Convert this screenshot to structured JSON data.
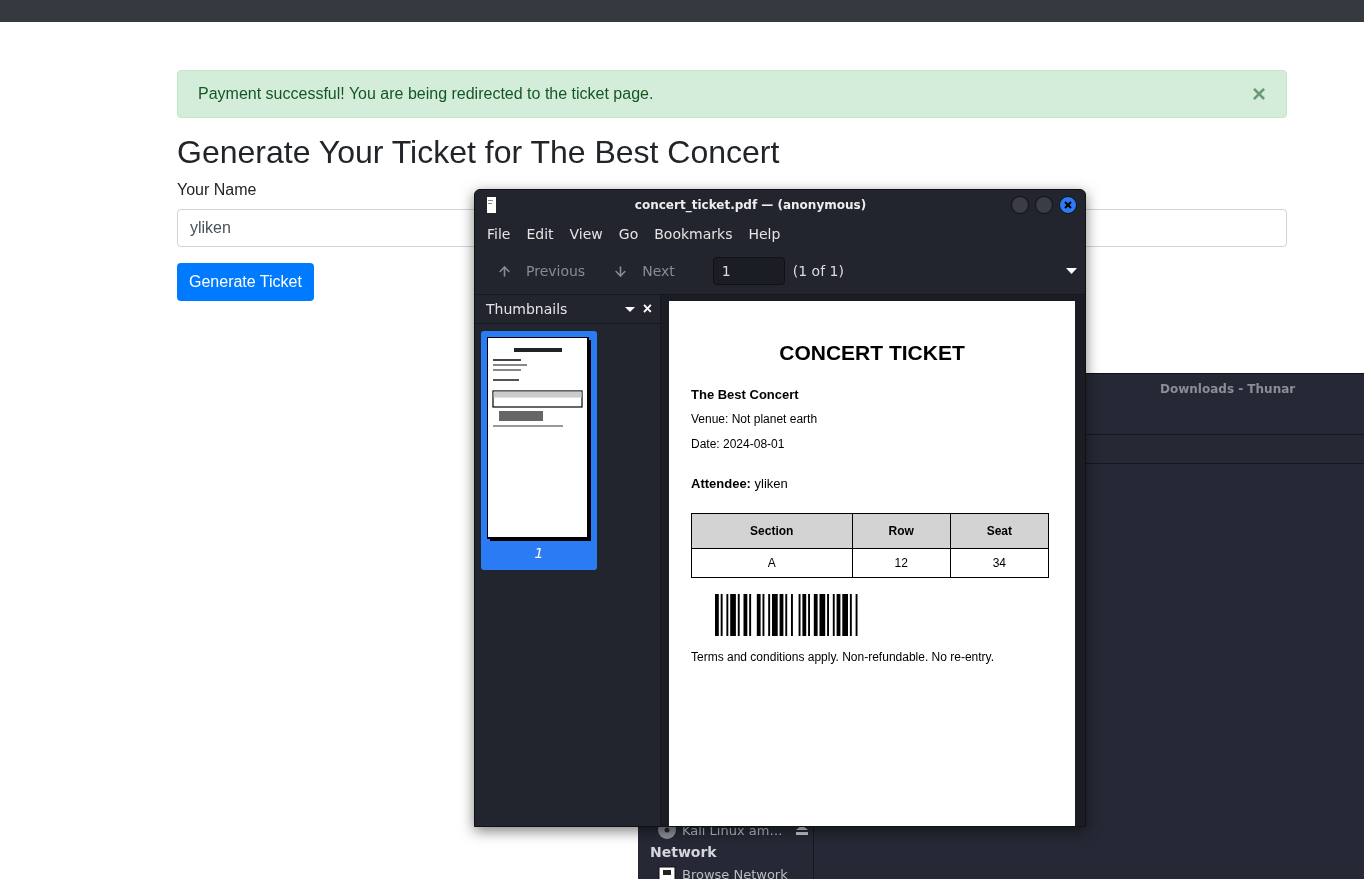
{
  "browser_page": {
    "alert": {
      "text": "Payment successful! You are being redirected to the ticket page.",
      "close": "×"
    },
    "heading": "Generate Your Ticket for The Best Concert",
    "name_label": "Your Name",
    "name_value": "yliken",
    "button": "Generate Ticket"
  },
  "pdf_viewer": {
    "title": "concert_ticket.pdf — (anonymous)",
    "menu": [
      "File",
      "Edit",
      "View",
      "Go",
      "Bookmarks",
      "Help"
    ],
    "toolbar": {
      "previous": "Previous",
      "next": "Next",
      "page_value": "1",
      "page_count": "(1 of 1)"
    },
    "sidebar": {
      "title": "Thumbnails",
      "close": "×",
      "thumbnails": [
        {
          "label": "1",
          "selected": true
        }
      ]
    },
    "document": {
      "title": "CONCERT TICKET",
      "event": "The Best Concert",
      "venue": "Venue: Not planet earth",
      "date": "Date: 2024-08-01",
      "attendee": "**Attendee:** yliken",
      "table": {
        "columns": [
          "Section",
          "Row",
          "Seat"
        ],
        "rows": [
          [
            "A",
            "12",
            "34"
          ]
        ]
      },
      "terms": "Terms and conditions apply. Non-refundable. No re-entry."
    }
  },
  "file_manager": {
    "title": "Downloads - Thunar",
    "sidebar_items": [
      {
        "kind": "device",
        "label": "Kali Linux am…"
      },
      {
        "kind": "heading",
        "label": "Network"
      },
      {
        "kind": "network",
        "label": "Browse Network"
      }
    ]
  }
}
